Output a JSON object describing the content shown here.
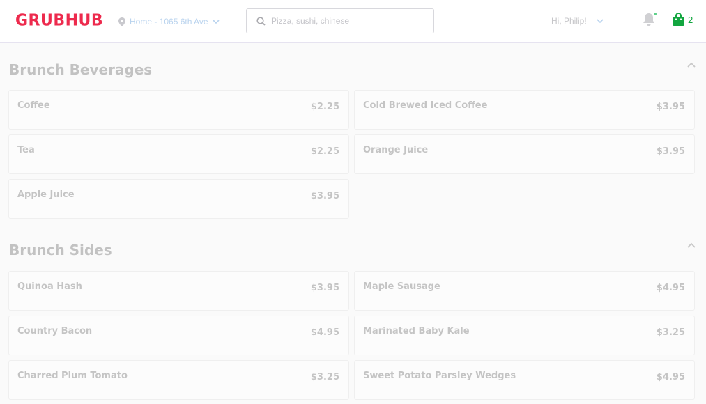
{
  "header": {
    "logo": "GRUBHUB",
    "location": "Home - 1065 6th Ave",
    "search_placeholder": "Pizza, sushi, chinese",
    "greeting": "Hi, Philip!",
    "cart_count": "2"
  },
  "icons": {
    "location": "map-pin-icon",
    "search": "search-icon",
    "bell": "bell-icon",
    "cart": "shopping-bag-icon",
    "chevron": "chevron-down-icon",
    "collapse": "chevron-up-icon"
  },
  "colors": {
    "brand": "#ed2a4d",
    "cart": "#13a640",
    "notification_dot": "#5fd08a"
  },
  "sections": [
    {
      "title": "Brunch Beverages",
      "items": [
        {
          "name": "Coffee",
          "price": "$2.25"
        },
        {
          "name": "Cold Brewed Iced Coffee",
          "price": "$3.95"
        },
        {
          "name": "Tea",
          "price": "$2.25"
        },
        {
          "name": "Orange Juice",
          "price": "$3.95"
        },
        {
          "name": "Apple Juice",
          "price": "$3.95"
        }
      ]
    },
    {
      "title": "Brunch Sides",
      "items": [
        {
          "name": "Quinoa Hash",
          "price": "$3.95"
        },
        {
          "name": "Maple Sausage",
          "price": "$4.95"
        },
        {
          "name": "Country Bacon",
          "price": "$4.95"
        },
        {
          "name": "Marinated Baby Kale",
          "price": "$3.25"
        },
        {
          "name": "Charred Plum Tomato",
          "price": "$3.25"
        },
        {
          "name": "Sweet Potato Parsley Wedges",
          "price": "$4.95"
        }
      ]
    }
  ]
}
